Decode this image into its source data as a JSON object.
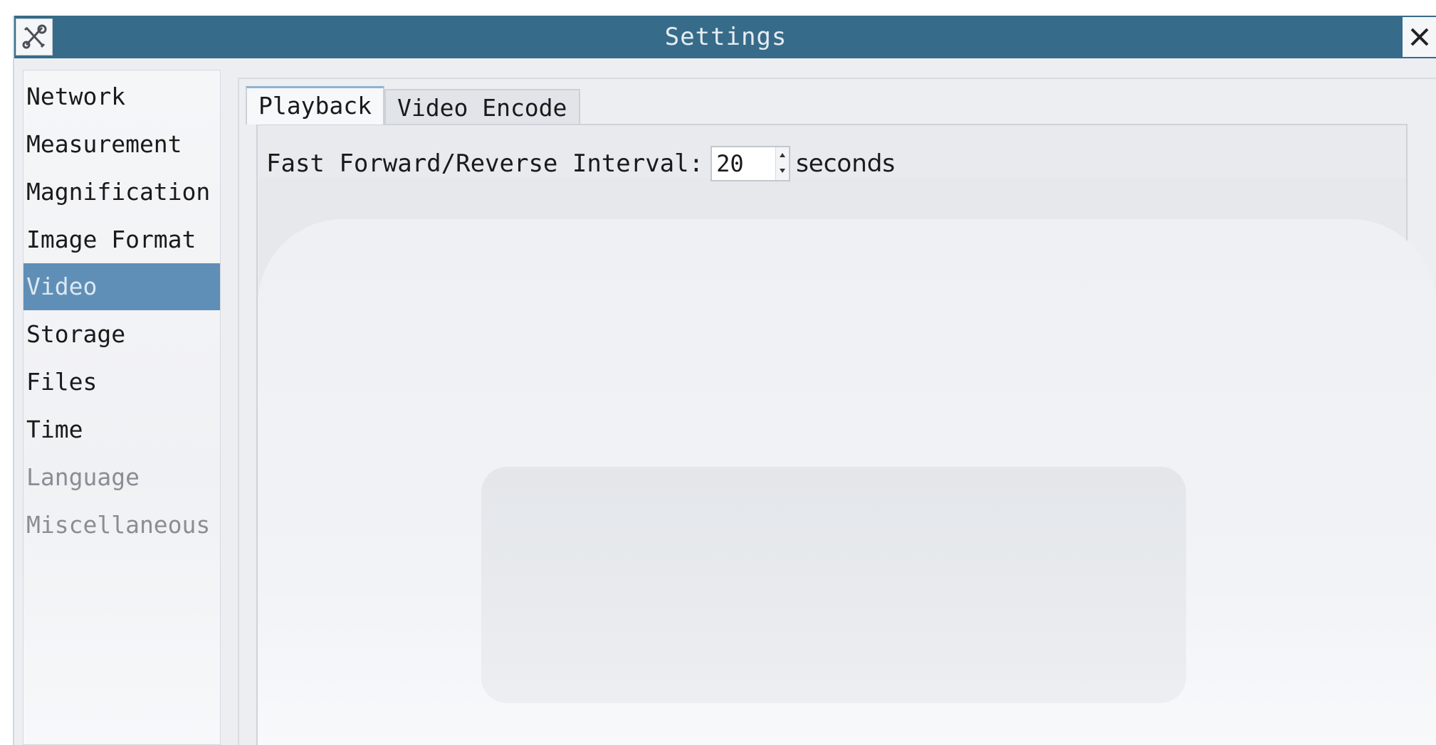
{
  "window": {
    "title": "Settings",
    "app_icon": "tools-icon",
    "close_icon": "close-icon"
  },
  "sidebar": {
    "items": [
      {
        "label": "Network"
      },
      {
        "label": "Measurement"
      },
      {
        "label": "Magnification"
      },
      {
        "label": "Image Format"
      },
      {
        "label": "Video",
        "selected": true
      },
      {
        "label": "Storage"
      },
      {
        "label": "Files"
      },
      {
        "label": "Time"
      },
      {
        "label": "Language"
      },
      {
        "label": "Miscellaneous"
      }
    ]
  },
  "tabs": [
    {
      "label": "Playback",
      "active": true
    },
    {
      "label": "Video Encode",
      "active": false
    }
  ],
  "playback": {
    "interval_label": "Fast Forward/Reverse Interval:",
    "interval_value": "20",
    "interval_unit": "seconds"
  },
  "colors": {
    "titlebar": "#376b8a",
    "selected_item": "#5f8fb6"
  }
}
